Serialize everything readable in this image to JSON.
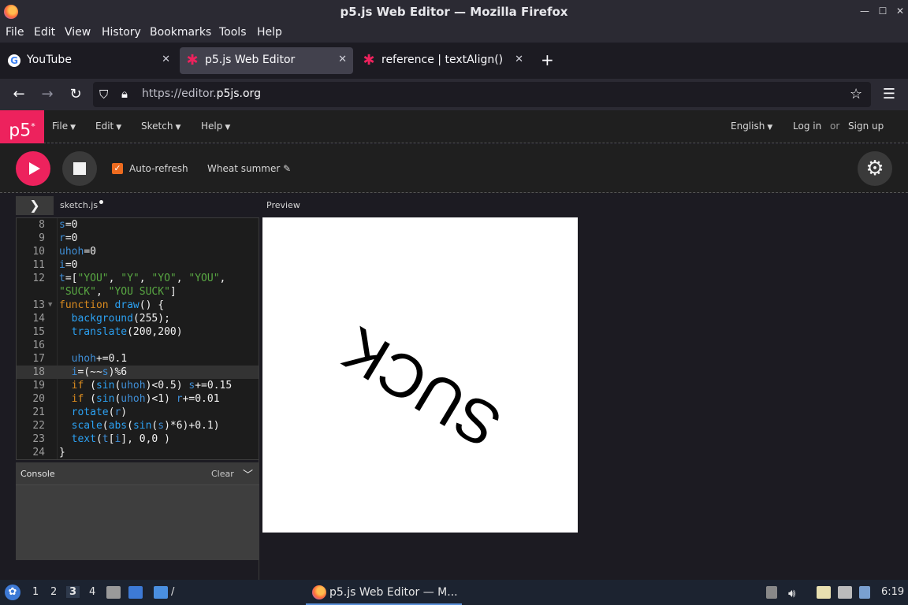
{
  "window": {
    "title": "p5.js Web Editor — Mozilla Firefox",
    "controls": [
      "—",
      "☐",
      "✕"
    ]
  },
  "menubar": [
    "File",
    "Edit",
    "View",
    "History",
    "Bookmarks",
    "Tools",
    "Help"
  ],
  "tabs": [
    {
      "label": "YouTube",
      "icon": "google-g-icon",
      "active": false
    },
    {
      "label": "p5.js Web Editor",
      "icon": "p5-asterisk-icon",
      "active": true
    },
    {
      "label": "reference | textAlign()",
      "icon": "p5-asterisk-icon",
      "active": false
    }
  ],
  "url": {
    "prefix": "https://editor.",
    "domain": "p5js.org"
  },
  "p5header": {
    "logo": "p5",
    "logo_sup": "*",
    "menus": [
      "File",
      "Edit",
      "Sketch",
      "Help"
    ],
    "language": "English",
    "login": "Log in",
    "or": "or",
    "signup": "Sign up"
  },
  "toolbar": {
    "auto_refresh_label": "Auto-refresh",
    "auto_refresh_checked": true,
    "sketch_name": "Wheat summer",
    "edit_glyph": "✎"
  },
  "editor": {
    "file_name": "sketch.js",
    "preview_label": "Preview",
    "highlight_line": 18,
    "lines": [
      {
        "n": "8",
        "html": "<span class='v'>s</span>=0"
      },
      {
        "n": "9",
        "html": "<span class='v'>r</span>=0"
      },
      {
        "n": "10",
        "html": "<span class='v'>uhoh</span>=0"
      },
      {
        "n": "11",
        "html": "<span class='v'>i</span>=0"
      },
      {
        "n": "12",
        "html": "<span class='v'>t</span>=[<span class='s'>\"YOU\"</span>, <span class='s'>\"Y\"</span>, <span class='s'>\"YO\"</span>, <span class='s'>\"YOU\"</span>,"
      },
      {
        "n": "",
        "html": "<span class='s'>\"SUCK\"</span>, <span class='s'>\"YOU SUCK\"</span>]"
      },
      {
        "n": "13",
        "html": "<span class='k'>function</span> <span class='f'>draw</span>() {",
        "fold": true
      },
      {
        "n": "14",
        "html": "  <span class='f'>background</span>(255);"
      },
      {
        "n": "15",
        "html": "  <span class='f'>translate</span>(200,200)"
      },
      {
        "n": "16",
        "html": ""
      },
      {
        "n": "17",
        "html": "  <span class='v'>uhoh</span>+=0.1"
      },
      {
        "n": "18",
        "html": "  <span class='v'>i</span>=(~~<span class='v'>s</span>)%6"
      },
      {
        "n": "19",
        "html": "  <span class='k'>if</span> (<span class='f'>sin</span>(<span class='v'>uhoh</span>)&lt;0.5) <span class='v'>s</span>+=0.15"
      },
      {
        "n": "20",
        "html": "  <span class='k'>if</span> (<span class='f'>sin</span>(<span class='v'>uhoh</span>)&lt;1) <span class='v'>r</span>+=0.01"
      },
      {
        "n": "21",
        "html": "  <span class='f'>rotate</span>(<span class='v'>r</span>)"
      },
      {
        "n": "22",
        "html": "  <span class='f'>scale</span>(<span class='f'>abs</span>(<span class='f'>sin</span>(<span class='v'>s</span>)*6)+0.1)"
      },
      {
        "n": "23",
        "html": "  <span class='f'>text</span>(<span class='v'>t</span>[<span class='v'>i</span>], 0,0 )"
      },
      {
        "n": "24",
        "html": "}"
      }
    ]
  },
  "console": {
    "title": "Console",
    "clear": "Clear"
  },
  "canvas": {
    "text": "SUCK",
    "background": "#ffffff"
  },
  "taskbar": {
    "workspaces": [
      "1",
      "2",
      "3",
      "4"
    ],
    "active_workspace": "3",
    "folder_label": "/",
    "window_label": "p5.js Web Editor — M...",
    "clock": "6:19"
  },
  "colors": {
    "p5_pink": "#ed225d",
    "checkbox_orange": "#ed6b1f"
  }
}
